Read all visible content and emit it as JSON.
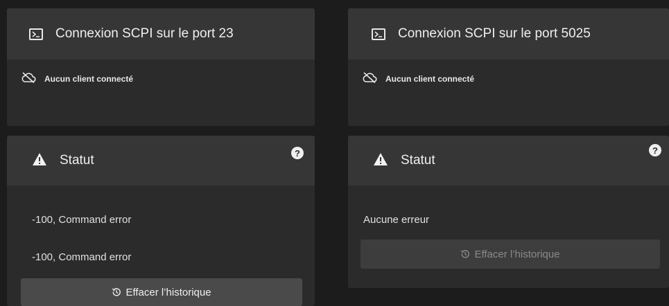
{
  "panels": [
    {
      "connection": {
        "title": "Connexion SCPI sur le port 23",
        "terminal_icon": "terminal-icon",
        "status_icon": "cloud-off-icon",
        "status_text": "Aucun client connecté"
      },
      "status": {
        "title": "Statut",
        "warning_icon": "warning-icon",
        "help_icon": "help-icon",
        "help_glyph": "?",
        "messages": [
          "-100, Command error",
          "-100, Command error"
        ],
        "clear_button": {
          "label": "Effacer l’historique",
          "icon": "history-icon",
          "enabled": true
        }
      }
    },
    {
      "connection": {
        "title": "Connexion SCPI sur le port 5025",
        "terminal_icon": "terminal-icon",
        "status_icon": "cloud-off-icon",
        "status_text": "Aucun client connecté"
      },
      "status": {
        "title": "Statut",
        "warning_icon": "warning-icon",
        "help_icon": "help-icon",
        "help_glyph": "?",
        "messages": [
          "Aucune erreur"
        ],
        "clear_button": {
          "label": "Effacer l’historique",
          "icon": "history-icon",
          "enabled": false
        }
      }
    }
  ],
  "colors": {
    "background": "#1c1c1c",
    "card": "#2b2b2b",
    "card_header": "#363636",
    "button_active": "#4a4a4a",
    "button_disabled": "#3d3d3d"
  }
}
